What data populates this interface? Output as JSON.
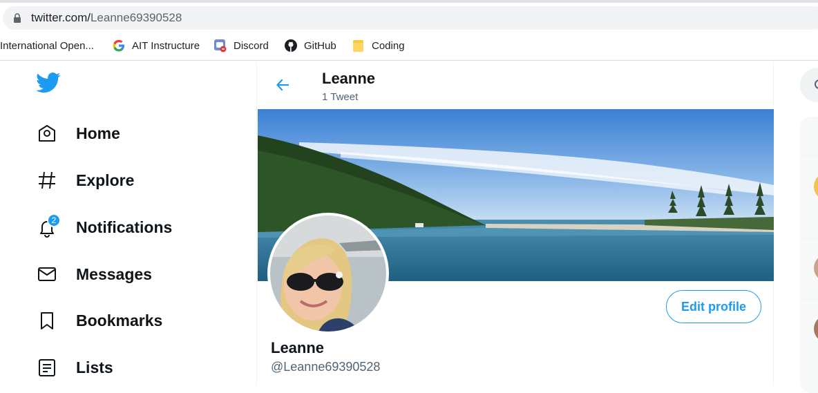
{
  "browser": {
    "url_host": "twitter.com/",
    "url_path": "Leanne69390528",
    "bookmarks": [
      {
        "label": "International Open...",
        "icon": "none"
      },
      {
        "label": "AIT Instructure",
        "icon": "google-icon"
      },
      {
        "label": "Discord",
        "icon": "discord-icon"
      },
      {
        "label": "GitHub",
        "icon": "github-icon"
      },
      {
        "label": "Coding",
        "icon": "folder-icon"
      }
    ]
  },
  "nav": {
    "items": [
      {
        "label": "Home",
        "icon": "home-icon"
      },
      {
        "label": "Explore",
        "icon": "hashtag-icon"
      },
      {
        "label": "Notifications",
        "icon": "bell-icon",
        "badge": "2"
      },
      {
        "label": "Messages",
        "icon": "envelope-icon"
      },
      {
        "label": "Bookmarks",
        "icon": "bookmark-icon"
      },
      {
        "label": "Lists",
        "icon": "list-icon"
      }
    ]
  },
  "header": {
    "name": "Leanne",
    "tweet_count": "1 Tweet"
  },
  "profile": {
    "name": "Leanne",
    "handle": "@Leanne69390528",
    "edit_label": "Edit profile"
  },
  "colors": {
    "accent": "#1d9bf0",
    "text": "#0f1419",
    "muted": "#536471"
  }
}
